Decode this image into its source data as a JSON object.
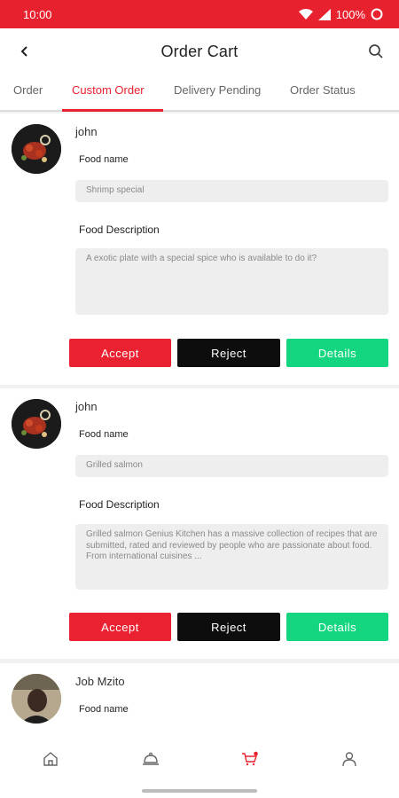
{
  "status_bar": {
    "time": "10:00",
    "battery": "100%"
  },
  "app_bar": {
    "title": "Order Cart"
  },
  "tabs": [
    {
      "label": "Order"
    },
    {
      "label": "Custom Order"
    },
    {
      "label": "Delivery Pending"
    },
    {
      "label": "Order Status"
    }
  ],
  "active_tab": "Custom Order",
  "orders": [
    {
      "customer": "john",
      "food_name_label": "Food name",
      "food_name": "Shrimp special",
      "food_description_label": "Food Description",
      "food_description": "A exotic plate with a special spice who is available to do it?",
      "accept_label": "Accept",
      "reject_label": "Reject",
      "details_label": "Details"
    },
    {
      "customer": "john",
      "food_name_label": "Food name",
      "food_name": "Grilled salmon",
      "food_description_label": "Food Description",
      "food_description": "Grilled salmon  Genius Kitchen has a massive collection of recipes that are submitted, rated and reviewed by people who are passionate about food. From international cuisines ...",
      "accept_label": "Accept",
      "reject_label": "Reject",
      "details_label": "Details"
    },
    {
      "customer": "Job Mzito",
      "food_name_label": "Food name"
    }
  ],
  "bottom_nav": [
    "home-icon",
    "cloche-icon",
    "cart-icon",
    "profile-icon"
  ],
  "colors": {
    "accent": "#e8212f",
    "reject": "#0d0d0d",
    "details": "#15d680"
  }
}
